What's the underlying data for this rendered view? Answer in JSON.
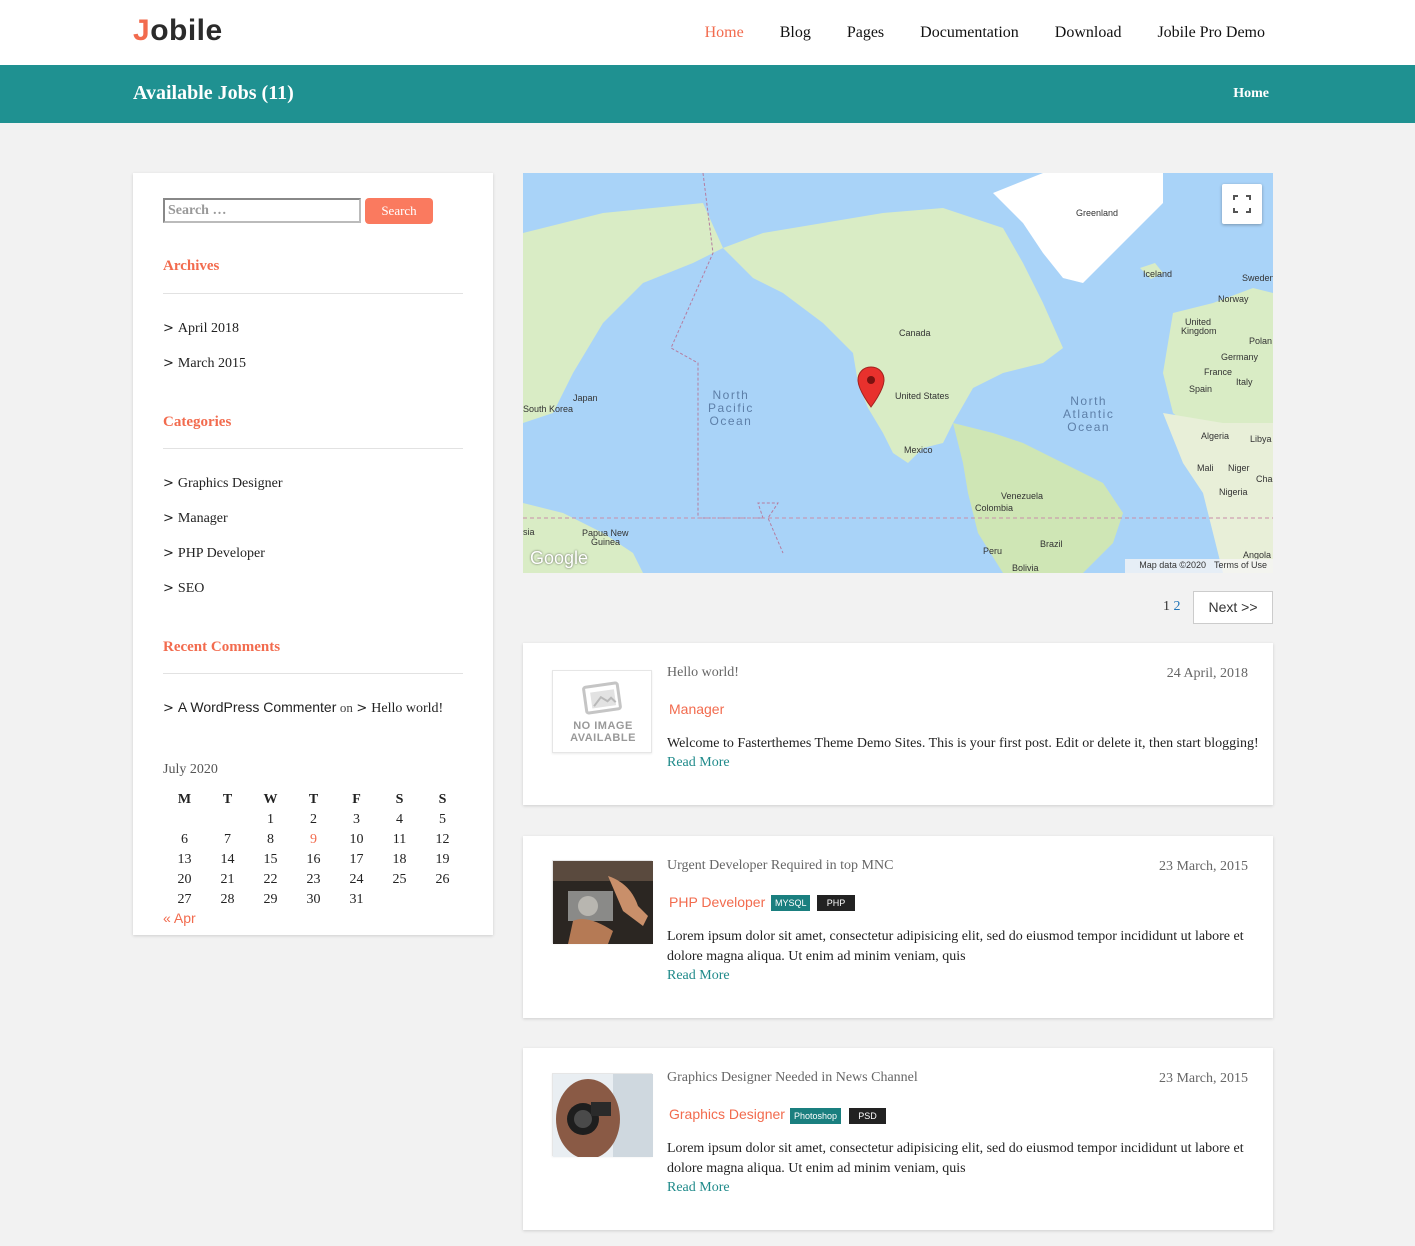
{
  "site": {
    "logo_first": "J",
    "logo_rest": "obile"
  },
  "nav": {
    "items": [
      "Home",
      "Blog",
      "Pages",
      "Documentation",
      "Download",
      "Jobile Pro Demo"
    ]
  },
  "banner": {
    "title": "Available Jobs (11)",
    "breadcrumb": "Home"
  },
  "sidebar": {
    "search": {
      "placeholder": "Search …",
      "button": "Search"
    },
    "archives": {
      "title": "Archives",
      "items": [
        "April 2018",
        "March 2015"
      ]
    },
    "categories": {
      "title": "Categories",
      "items": [
        "Graphics Designer",
        "Manager",
        "PHP Developer",
        "SEO"
      ]
    },
    "recent_comments": {
      "title": "Recent Comments",
      "author": "A WordPress Commenter",
      "on": "on",
      "post": "Hello world!"
    },
    "calendar": {
      "caption": "July 2020",
      "days": [
        "M",
        "T",
        "W",
        "T",
        "F",
        "S",
        "S"
      ],
      "weeks": [
        [
          "",
          "",
          "1",
          "2",
          "3",
          "4",
          "5"
        ],
        [
          "6",
          "7",
          "8",
          "9",
          "10",
          "11",
          "12"
        ],
        [
          "13",
          "14",
          "15",
          "16",
          "17",
          "18",
          "19"
        ],
        [
          "20",
          "21",
          "22",
          "23",
          "24",
          "25",
          "26"
        ],
        [
          "27",
          "28",
          "29",
          "30",
          "31",
          "",
          ""
        ]
      ],
      "today": "9",
      "prev": "« Apr"
    }
  },
  "map": {
    "labels": {
      "greenland": "Greenland",
      "iceland": "Iceland",
      "sweden": "Sweden",
      "norway": "Norway",
      "uk1": "United",
      "uk2": "Kingdom",
      "poland": "Polan",
      "germany": "Germany",
      "france": "France",
      "spain": "Spain",
      "italy": "Italy",
      "algeria": "Algeria",
      "libya": "Libya",
      "mali": "Mali",
      "niger": "Niger",
      "chad": "Chac",
      "nigeria": "Nigeria",
      "angola": "Angola",
      "canada": "Canada",
      "us": "United States",
      "mexico": "Mexico",
      "venezuela": "Venezuela",
      "colombia": "Colombia",
      "peru": "Peru",
      "brazil": "Brazil",
      "bolivia": "Bolivia",
      "japan": "Japan",
      "skorea": "South Korea",
      "png1": "Papua New",
      "png2": "Guinea",
      "asia": "sia"
    },
    "north_pacific": [
      "North",
      "Pacific",
      "Ocean"
    ],
    "north_atlantic": [
      "North",
      "Atlantic",
      "Ocean"
    ],
    "google": "Google",
    "attribution": "Map data ©2020",
    "terms": "Terms of Use"
  },
  "pagination": {
    "page1": "1",
    "page2": "2",
    "next": "Next >>"
  },
  "jobs": [
    {
      "title": "Hello world!",
      "date": "24 April, 2018",
      "category": "Manager",
      "tags": [],
      "excerpt": "Welcome to Fasterthemes Theme Demo Sites. This is your first post. Edit or delete it, then start blogging!",
      "more": "Read More",
      "thumb_text": [
        "NO IMAGE",
        "AVAILABLE"
      ]
    },
    {
      "title": "Urgent Developer Required in top MNC",
      "date": "23 March, 2015",
      "category": "PHP Developer",
      "tags": [
        "MYSQL",
        "PHP"
      ],
      "excerpt": "Lorem ipsum dolor sit amet, consectetur adipisicing elit, sed do eiusmod tempor incididunt ut labore et dolore magna aliqua. Ut enim ad minim veniam, quis",
      "more": "Read More"
    },
    {
      "title": "Graphics Designer Needed in News Channel",
      "date": "23 March, 2015",
      "category": "Graphics Designer",
      "tags": [
        "Photoshop",
        "PSD"
      ],
      "excerpt": "Lorem ipsum dolor sit amet, consectetur adipisicing elit, sed do eiusmod tempor incididunt ut labore et dolore magna aliqua. Ut enim ad minim veniam, quis",
      "more": "Read More"
    }
  ]
}
